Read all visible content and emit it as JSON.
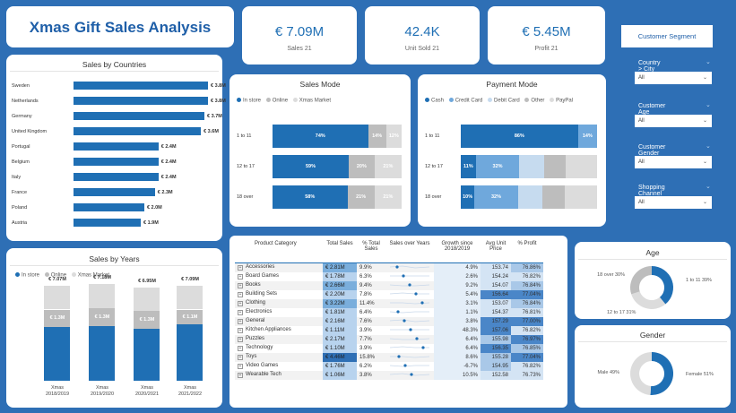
{
  "title": "Xmas Gift Sales Analysis",
  "kpis": [
    {
      "value": "€ 7.09M",
      "label": "Sales 21"
    },
    {
      "value": "42.4K",
      "label": "Unit Sold 21"
    },
    {
      "value": "€ 5.45M",
      "label": "Profit 21"
    }
  ],
  "colors": {
    "primary": "#1f6fb4",
    "mid": "#6fa8dc",
    "light": "#c6dbef",
    "gray": "#bdbdbd",
    "lightgray": "#dcdcdc",
    "background": "#2e6fb5"
  },
  "countries": {
    "title": "Sales by Countries",
    "rows": [
      {
        "label": "Sweden",
        "value": 3.8,
        "text": "€ 3.8M"
      },
      {
        "label": "Netherlands",
        "value": 3.8,
        "text": "€ 3.8M"
      },
      {
        "label": "Germany",
        "value": 3.7,
        "text": "€ 3.7M"
      },
      {
        "label": "United Kingdom",
        "value": 3.6,
        "text": "€ 3.6M"
      },
      {
        "label": "Portugal",
        "value": 2.4,
        "text": "€ 2.4M"
      },
      {
        "label": "Belgium",
        "value": 2.4,
        "text": "€ 2.4M"
      },
      {
        "label": "Italy",
        "value": 2.4,
        "text": "€ 2.4M"
      },
      {
        "label": "France",
        "value": 2.3,
        "text": "€ 2.3M"
      },
      {
        "label": "Poland",
        "value": 2.0,
        "text": "€ 2.0M"
      },
      {
        "label": "Austria",
        "value": 1.9,
        "text": "€ 1.9M"
      }
    ]
  },
  "sales_mode": {
    "title": "Sales Mode",
    "legend": [
      "In store",
      "Online",
      "Xmas Market"
    ],
    "rows": [
      {
        "label": "1 to 11",
        "segments": [
          74,
          14,
          12
        ],
        "texts": [
          "74%",
          "14%",
          "12%"
        ]
      },
      {
        "label": "12 to 17",
        "segments": [
          59,
          20,
          21
        ],
        "texts": [
          "59%",
          "20%",
          "21%"
        ]
      },
      {
        "label": "18 over",
        "segments": [
          58,
          21,
          21
        ],
        "texts": [
          "58%",
          "21%",
          "21%"
        ]
      }
    ]
  },
  "payment_mode": {
    "title": "Payment Mode",
    "legend": [
      "Cash",
      "Credit Card",
      "Debit Card",
      "Other",
      "PayPal"
    ],
    "rows": [
      {
        "label": "1 to 11",
        "segments": [
          86,
          14,
          0,
          0,
          0
        ],
        "texts": [
          "86%",
          "14%",
          "",
          "",
          ""
        ]
      },
      {
        "label": "12 to 17",
        "segments": [
          11,
          32,
          18,
          16,
          23
        ],
        "texts": [
          "11%",
          "32%",
          "",
          "",
          ""
        ]
      },
      {
        "label": "18 over",
        "segments": [
          10,
          32,
          18,
          16,
          24
        ],
        "texts": [
          "10%",
          "32%",
          "",
          "",
          ""
        ]
      }
    ]
  },
  "sales_years": {
    "title": "Sales by Years",
    "legend": [
      "In store",
      "Online",
      "Xmas Market"
    ],
    "columns": [
      {
        "label": "Xmas 2018/2019",
        "total": "€ 7.07M",
        "instore": "€ 1.3M",
        "parts": [
          4.0,
          1.3,
          1.77
        ]
      },
      {
        "label": "Xmas 2019/2020",
        "total": "€ 7.18M",
        "instore": "€ 1.3M",
        "parts": [
          4.1,
          1.3,
          1.78
        ]
      },
      {
        "label": "Xmas 2020/2021",
        "total": "€ 6.95M",
        "instore": "€ 1.3M",
        "parts": [
          3.9,
          1.3,
          1.75
        ]
      },
      {
        "label": "Xmas 2021/2022",
        "total": "€ 7.09M",
        "instore": "€ 1.1M",
        "parts": [
          4.2,
          1.1,
          1.79
        ]
      }
    ]
  },
  "table": {
    "headers": [
      "Product Category",
      "Total Sales",
      "% Total Sales",
      "Sales over Years",
      "Growth since 2018/2019",
      "Avg Unit Price",
      "% Profit"
    ],
    "rows": [
      {
        "category": "Accessories",
        "sales": "€ 2.81M",
        "pct": "9.9%",
        "growth": "4.9%",
        "price": "153.74",
        "profit": "76.86%"
      },
      {
        "category": "Board Games",
        "sales": "€ 1.78M",
        "pct": "6.3%",
        "growth": "2.6%",
        "price": "154.24",
        "profit": "76.82%"
      },
      {
        "category": "Books",
        "sales": "€ 2.66M",
        "pct": "9.4%",
        "growth": "9.2%",
        "price": "154.07",
        "profit": "76.84%"
      },
      {
        "category": "Building Sets",
        "sales": "€ 2.20M",
        "pct": "7.8%",
        "growth": "5.4%",
        "price": "156.64",
        "profit": "77.04%"
      },
      {
        "category": "Clothing",
        "sales": "€ 3.22M",
        "pct": "11.4%",
        "growth": "3.1%",
        "price": "153.07",
        "profit": "76.84%"
      },
      {
        "category": "Electronics",
        "sales": "€ 1.81M",
        "pct": "6.4%",
        "growth": "1.1%",
        "price": "154.37",
        "profit": "76.81%"
      },
      {
        "category": "General",
        "sales": "€ 2.16M",
        "pct": "7.6%",
        "growth": "3.8%",
        "price": "157.29",
        "profit": "77.00%"
      },
      {
        "category": "Kitchen Appliances",
        "sales": "€ 1.11M",
        "pct": "3.9%",
        "growth": "48.3%",
        "price": "157.06",
        "profit": "76.82%"
      },
      {
        "category": "Puzzles",
        "sales": "€ 2.17M",
        "pct": "7.7%",
        "growth": "6.4%",
        "price": "155.98",
        "profit": "76.97%"
      },
      {
        "category": "Technology",
        "sales": "€ 1.10M",
        "pct": "3.9%",
        "growth": "6.4%",
        "price": "156.35",
        "profit": "76.85%"
      },
      {
        "category": "Toys",
        "sales": "€ 4.46M",
        "pct": "15.8%",
        "growth": "8.6%",
        "price": "155.28",
        "profit": "77.04%"
      },
      {
        "category": "Video Games",
        "sales": "€ 1.76M",
        "pct": "6.2%",
        "growth": "-6.7%",
        "price": "154.95",
        "profit": "76.82%"
      },
      {
        "category": "Wearable Tech",
        "sales": "€ 1.06M",
        "pct": "3.8%",
        "growth": "10.5%",
        "price": "152.58",
        "profit": "76.73%"
      }
    ]
  },
  "segment": {
    "title": "Customer Segment",
    "slicers": [
      {
        "label": "Country > City",
        "value": "All"
      },
      {
        "label": "Customer Age",
        "value": "All"
      },
      {
        "label": "Customer Gender",
        "value": "All"
      },
      {
        "label": "Shopping Channel",
        "value": "All"
      }
    ]
  },
  "age": {
    "title": "Age",
    "slices": [
      {
        "label": "1 to 11 39%",
        "value": 39
      },
      {
        "label": "12 to 17 31%",
        "value": 31
      },
      {
        "label": "18 over 30%",
        "value": 30
      }
    ]
  },
  "gender": {
    "title": "Gender",
    "slices": [
      {
        "label": "Female 51%",
        "value": 51
      },
      {
        "label": "Male 49%",
        "value": 49
      }
    ]
  },
  "chart_data": [
    {
      "type": "bar",
      "title": "Sales by Countries",
      "categories": [
        "Sweden",
        "Netherlands",
        "Germany",
        "United Kingdom",
        "Portugal",
        "Belgium",
        "Italy",
        "France",
        "Poland",
        "Austria"
      ],
      "values": [
        3.8,
        3.8,
        3.7,
        3.6,
        2.4,
        2.4,
        2.4,
        2.3,
        2.0,
        1.9
      ]
    },
    {
      "type": "bar",
      "title": "Sales Mode",
      "categories": [
        "1 to 11",
        "12 to 17",
        "18 over"
      ],
      "series": [
        {
          "name": "In store",
          "values": [
            74,
            59,
            58
          ]
        },
        {
          "name": "Online",
          "values": [
            14,
            20,
            21
          ]
        },
        {
          "name": "Xmas Market",
          "values": [
            12,
            21,
            21
          ]
        }
      ]
    },
    {
      "type": "bar",
      "title": "Payment Mode",
      "categories": [
        "1 to 11",
        "12 to 17",
        "18 over"
      ],
      "series": [
        {
          "name": "Cash",
          "values": [
            86,
            11,
            10
          ]
        },
        {
          "name": "Credit Card",
          "values": [
            14,
            32,
            32
          ]
        },
        {
          "name": "Debit Card",
          "values": [
            0,
            18,
            18
          ]
        },
        {
          "name": "Other",
          "values": [
            0,
            16,
            16
          ]
        },
        {
          "name": "PayPal",
          "values": [
            0,
            23,
            24
          ]
        }
      ]
    },
    {
      "type": "bar",
      "title": "Sales by Years",
      "categories": [
        "Xmas 2018/2019",
        "Xmas 2019/2020",
        "Xmas 2020/2021",
        "Xmas 2021/2022"
      ],
      "values": [
        7.07,
        7.18,
        6.95,
        7.09
      ]
    },
    {
      "type": "pie",
      "title": "Age",
      "categories": [
        "1 to 11",
        "12 to 17",
        "18 over"
      ],
      "values": [
        39,
        31,
        30
      ]
    },
    {
      "type": "pie",
      "title": "Gender",
      "categories": [
        "Female",
        "Male"
      ],
      "values": [
        51,
        49
      ]
    }
  ]
}
